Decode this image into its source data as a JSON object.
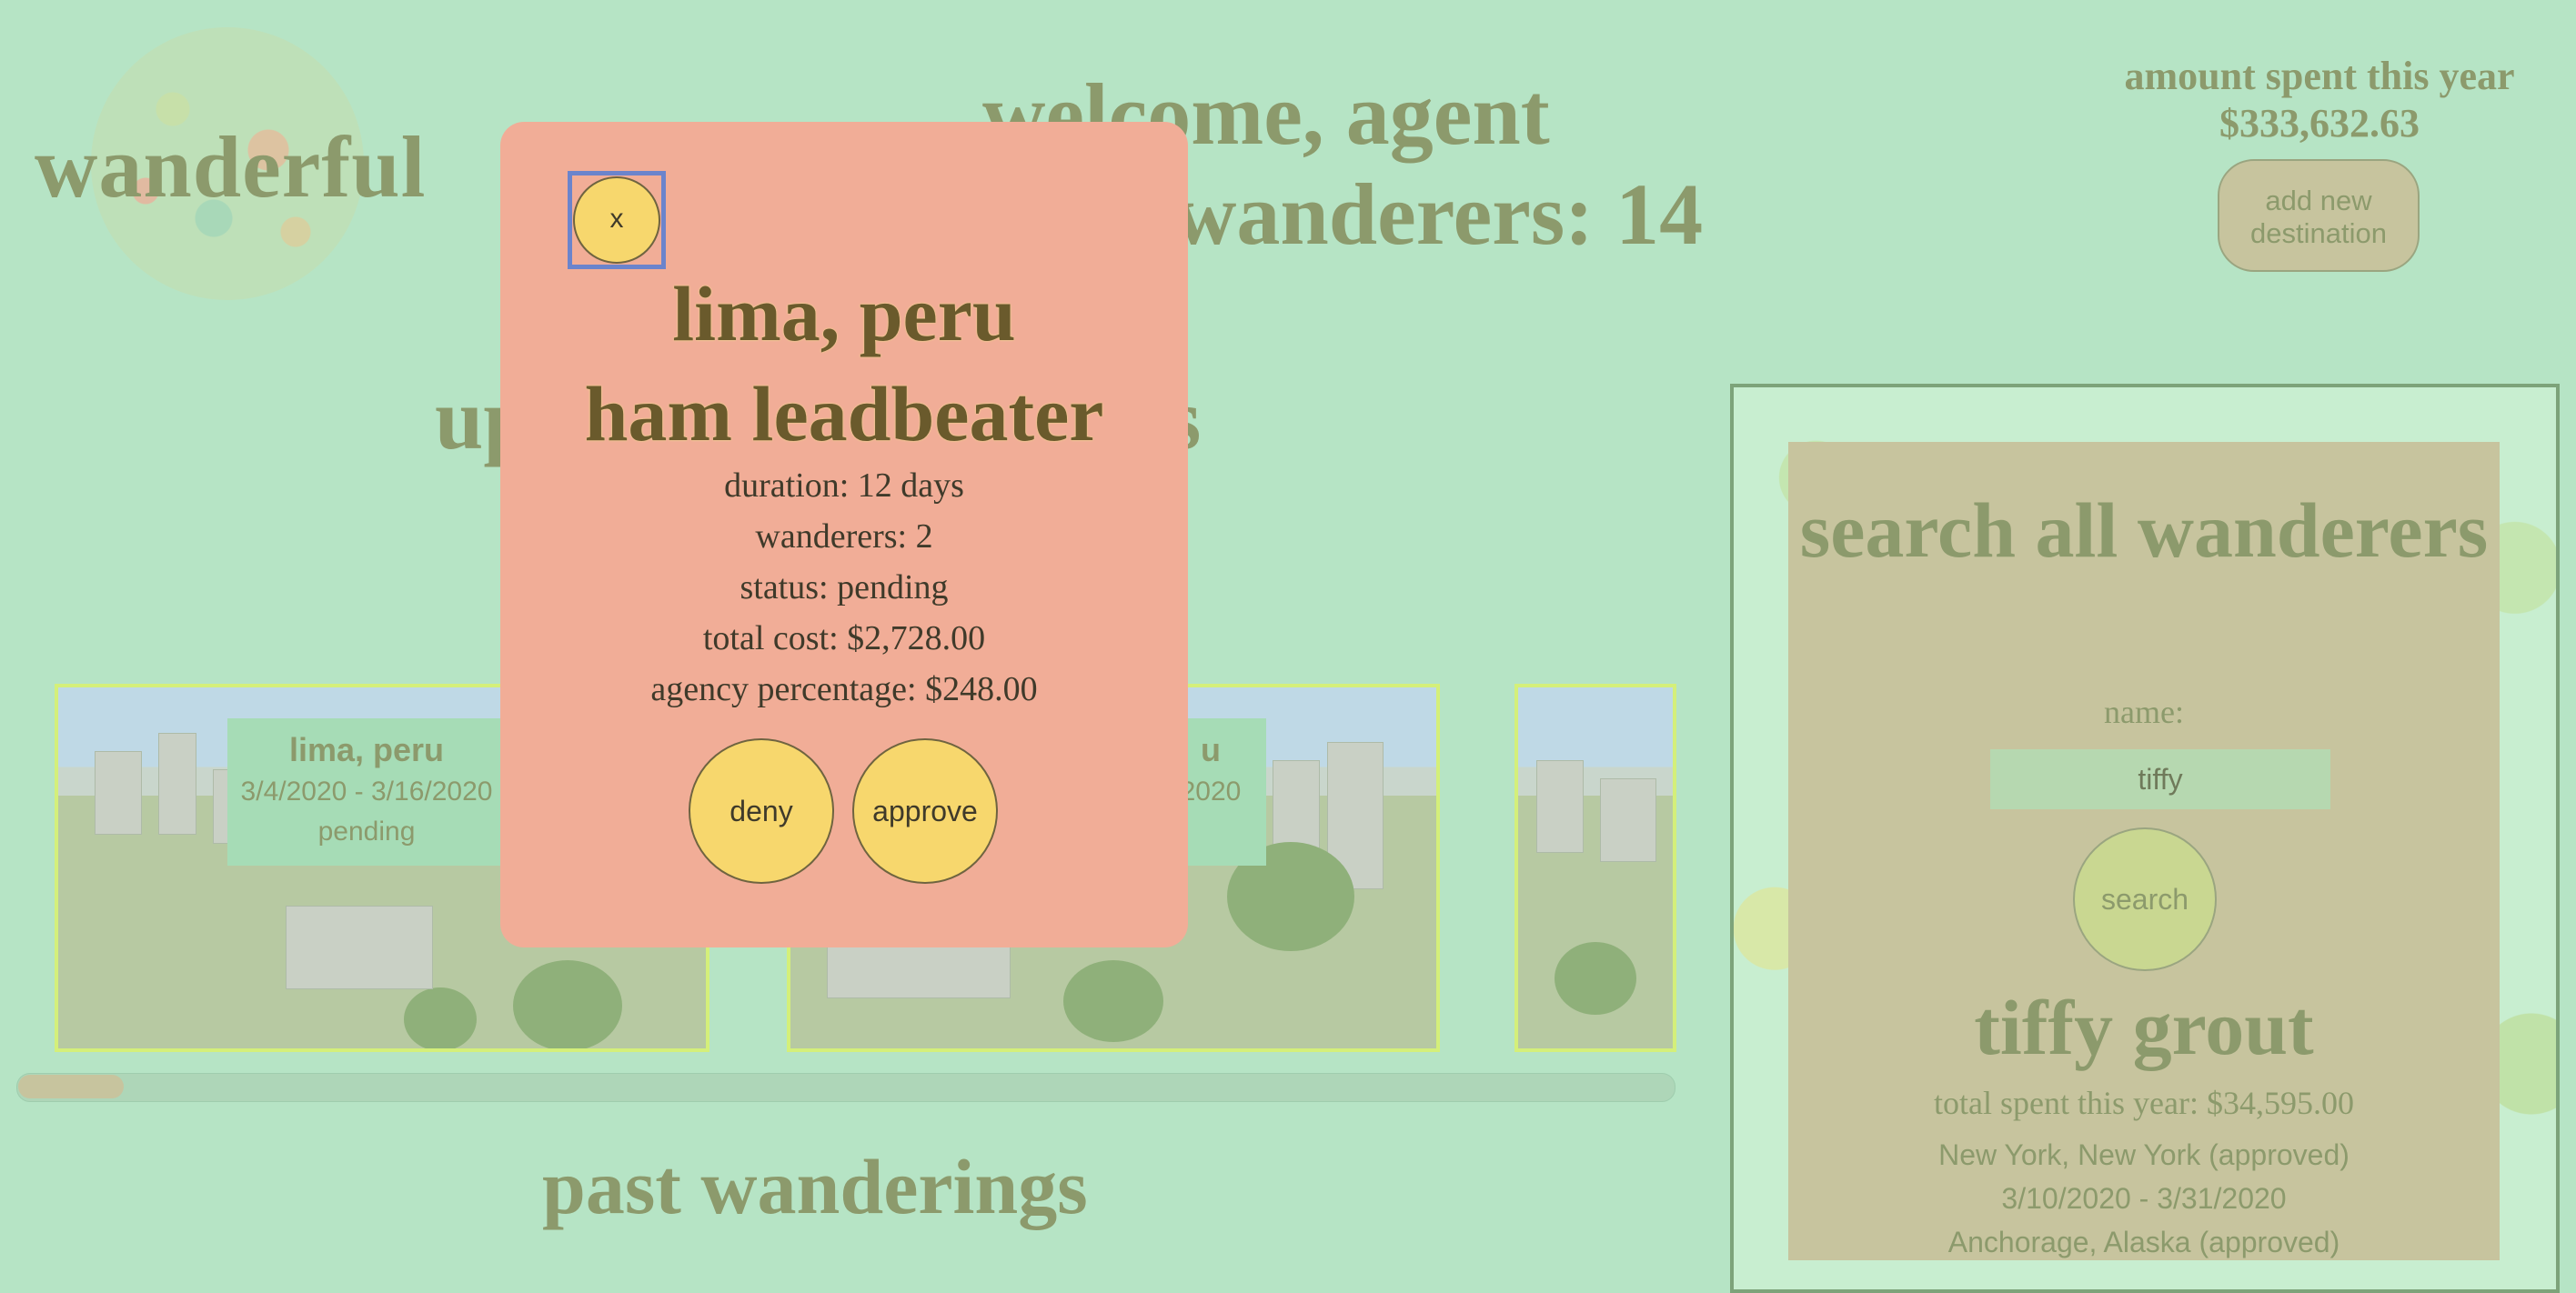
{
  "app": {
    "logo_text": "wanderful",
    "welcome": "welcome, agent",
    "wanderers_count": "wanderers: 14"
  },
  "summary": {
    "amount_label": "amount spent this year",
    "amount_value": "$333,632.63",
    "add_destination_label": "add new\ndestination"
  },
  "sections": {
    "upcoming_left": "up",
    "upcoming_right": "gs",
    "past": "past wanderings"
  },
  "cards": [
    {
      "title": "lima, peru",
      "dates": "3/4/2020 - 3/16/2020",
      "status": "pending"
    },
    {
      "title": "u",
      "dates": "2020"
    }
  ],
  "search": {
    "title": "search all wanderers",
    "name_label": "name:",
    "name_value": "tiffy",
    "button_label": "search",
    "result_name": "tiffy grout",
    "result_total": "total spent this year: $34,595.00",
    "result_lines": [
      "New York, New York (approved)",
      "3/10/2020 - 3/31/2020",
      "Anchorage, Alaska (approved)"
    ]
  },
  "modal": {
    "close_label": "x",
    "title_line1": "lima, peru",
    "title_line2": "ham leadbeater",
    "duration": "duration: 12 days",
    "wanderers": "wanderers: 2",
    "status": "status: pending",
    "total_cost": "total cost: $2,728.00",
    "agency_percentage": "agency percentage: $248.00",
    "deny_label": "deny",
    "approve_label": "approve"
  },
  "colors": {
    "background": "#b6e4c5",
    "muted_text": "#8c9a6c",
    "modal_bg": "#f1ad97",
    "button_yellow": "#f7d76d",
    "panel_tan": "#c7c49e",
    "focus_ring": "#6b84cc"
  }
}
